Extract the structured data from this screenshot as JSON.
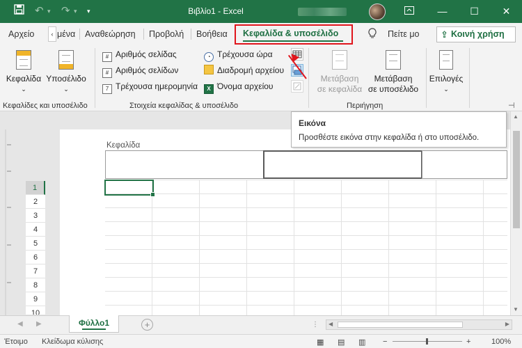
{
  "titlebar": {
    "title": "Βιβλίο1  -  Excel",
    "icons": [
      "save-icon",
      "undo-icon",
      "redo-icon",
      "customize-icon"
    ],
    "window_buttons": [
      "ribbon-display",
      "minimize",
      "maximize",
      "close"
    ]
  },
  "tabs": {
    "file": "Αρχείο",
    "partial": "μένα",
    "review": "Αναθεώρηση",
    "view": "Προβολή",
    "help": "Βοήθεια",
    "active": "Κεφαλίδα & υποσέλιδο",
    "tell_me": "Πείτε μο",
    "share": "Κοινή χρήση"
  },
  "ribbon": {
    "group1": {
      "header": "Κεφαλίδα",
      "footer": "Υποσέλιδο",
      "label": "Κεφαλίδες και υποσέλιδο"
    },
    "group2": {
      "page_number": "Αριθμός σελίδας",
      "number_of_pages": "Αριθμός σελίδων",
      "current_date": "Τρέχουσα ημερομηνία",
      "current_time": "Τρέχουσα ώρα",
      "file_path": "Διαδρομή αρχείου",
      "file_name": "Όνομα αρχείου",
      "label": "Στοιχεία κεφαλίδας & υποσέλιδο"
    },
    "group3": {
      "goto_header_l1": "Μετάβαση",
      "goto_header_l2": "σε κεφαλίδα",
      "goto_footer_l1": "Μετάβαση",
      "goto_footer_l2": "σε υποσέλιδο",
      "label": "Περιήγηση"
    },
    "group4": {
      "options": "Επιλογές"
    }
  },
  "tooltip": {
    "title": "Εικόνα",
    "description": "Προσθέστε εικόνα στην κεφαλίδα ή στο υποσέλιδο."
  },
  "sheet": {
    "header_label": "Κεφαλίδα",
    "rows": [
      "1",
      "2",
      "3",
      "4",
      "5",
      "6",
      "7",
      "8",
      "9",
      "10"
    ],
    "selected_row": "1"
  },
  "sheet_tabs": {
    "active": "Φύλλο1",
    "add": "+"
  },
  "status": {
    "ready": "Έτοιμο",
    "scroll_lock": "Κλείδωμα κύλισης",
    "zoom": "100%"
  },
  "colors": {
    "accent": "#217346",
    "highlight_red": "#e0151c"
  }
}
